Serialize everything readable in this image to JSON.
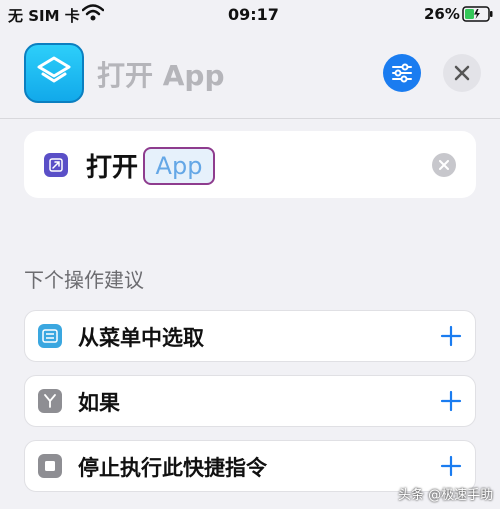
{
  "status_bar": {
    "carrier": "无 SIM 卡",
    "time": "09:17",
    "battery": "26%"
  },
  "header": {
    "title": "打开 App",
    "app_icon": "shortcuts-icon",
    "settings_icon": "sliders-icon",
    "close_icon": "close-icon"
  },
  "action": {
    "verb": "打开",
    "param": "App",
    "icon": "open-arrow-icon"
  },
  "suggestions": {
    "title": "下个操作建议",
    "items": [
      {
        "label": "从菜单中选取",
        "icon": "menu-icon",
        "color": "#3aa7e0"
      },
      {
        "label": "如果",
        "icon": "branch-icon",
        "color": "#8e8e93"
      },
      {
        "label": "停止执行此快捷指令",
        "icon": "stop-icon",
        "color": "#8e8e93"
      }
    ]
  },
  "watermark": "头条 @极速手助",
  "colors": {
    "accent": "#1a7cf0",
    "param_border": "#8e3c8e",
    "param_text": "#64a7e6"
  }
}
